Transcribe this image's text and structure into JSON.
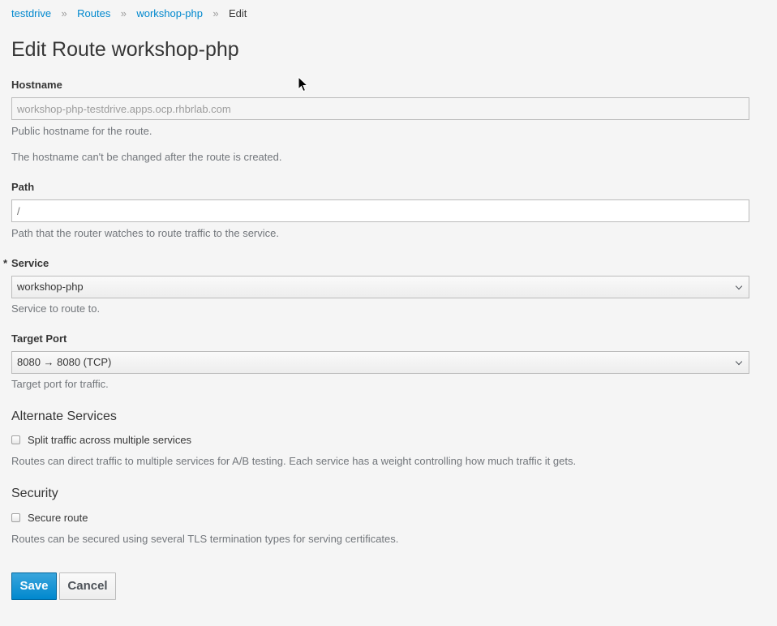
{
  "breadcrumb": {
    "items": [
      "testdrive",
      "Routes",
      "workshop-php"
    ],
    "current": "Edit",
    "separator": "»"
  },
  "page_title": "Edit Route workshop-php",
  "hostname": {
    "label": "Hostname",
    "value": "workshop-php-testdrive.apps.ocp.rhbrlab.com",
    "help1": "Public hostname for the route.",
    "help2": "The hostname can't be changed after the route is created."
  },
  "path": {
    "label": "Path",
    "placeholder": "/",
    "help": "Path that the router watches to route traffic to the service."
  },
  "service": {
    "required_marker": "*",
    "label": "Service",
    "selected": "workshop-php",
    "help": "Service to route to."
  },
  "target_port": {
    "label": "Target Port",
    "selected": "8080 → 8080 (TCP)",
    "help": "Target port for traffic."
  },
  "alternate_services": {
    "heading": "Alternate Services",
    "checkbox_label": "Split traffic across multiple services",
    "help": "Routes can direct traffic to multiple services for A/B testing. Each service has a weight controlling how much traffic it gets."
  },
  "security": {
    "heading": "Security",
    "checkbox_label": "Secure route",
    "help": "Routes can be secured using several TLS termination types for serving certificates."
  },
  "buttons": {
    "save": "Save",
    "cancel": "Cancel"
  },
  "colors": {
    "link": "#0088ce",
    "primary": "#0088ce",
    "help_text": "#72767b"
  }
}
